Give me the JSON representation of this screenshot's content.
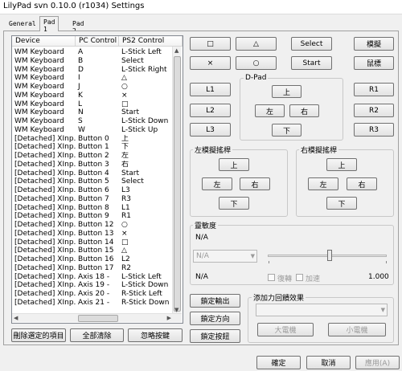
{
  "window": {
    "title": "LilyPad svn 0.10.0 (r1034) Settings"
  },
  "tabs": [
    "General",
    "Pad 1",
    "Pad 2"
  ],
  "list": {
    "headers": [
      "Device",
      "PC Control",
      "PS2 Control"
    ],
    "rows": [
      [
        "WM Keyboard",
        "A",
        "L-Stick Left"
      ],
      [
        "WM Keyboard",
        "B",
        "Select"
      ],
      [
        "WM Keyboard",
        "D",
        "L-Stick Right"
      ],
      [
        "WM Keyboard",
        "I",
        "△"
      ],
      [
        "WM Keyboard",
        "J",
        "○"
      ],
      [
        "WM Keyboard",
        "K",
        "×"
      ],
      [
        "WM Keyboard",
        "L",
        "□"
      ],
      [
        "WM Keyboard",
        "N",
        "Start"
      ],
      [
        "WM Keyboard",
        "S",
        "L-Stick Down"
      ],
      [
        "WM Keyboard",
        "W",
        "L-Stick Up"
      ],
      [
        "[Detached] XInp...",
        "Button 0",
        "上"
      ],
      [
        "[Detached] XInp...",
        "Button 1",
        "下"
      ],
      [
        "[Detached] XInp...",
        "Button 2",
        "左"
      ],
      [
        "[Detached] XInp...",
        "Button 3",
        "右"
      ],
      [
        "[Detached] XInp...",
        "Button 4",
        "Start"
      ],
      [
        "[Detached] XInp...",
        "Button 5",
        "Select"
      ],
      [
        "[Detached] XInp...",
        "Button 6",
        "L3"
      ],
      [
        "[Detached] XInp...",
        "Button 7",
        "R3"
      ],
      [
        "[Detached] XInp...",
        "Button 8",
        "L1"
      ],
      [
        "[Detached] XInp...",
        "Button 9",
        "R1"
      ],
      [
        "[Detached] XInp...",
        "Button 12",
        "○"
      ],
      [
        "[Detached] XInp...",
        "Button 13",
        "×"
      ],
      [
        "[Detached] XInp...",
        "Button 14",
        "□"
      ],
      [
        "[Detached] XInp...",
        "Button 15",
        "△"
      ],
      [
        "[Detached] XInp...",
        "Button 16",
        "L2"
      ],
      [
        "[Detached] XInp...",
        "Button 17",
        "R2"
      ],
      [
        "[Detached] XInp...",
        "Axis 18 -",
        "L-Stick Left"
      ],
      [
        "[Detached] XInp...",
        "Axis 19 -",
        "L-Stick Down"
      ],
      [
        "[Detached] XInp...",
        "Axis 20 -",
        "R-Stick Left"
      ],
      [
        "[Detached] XInp...",
        "Axis 21 -",
        "R-Stick Down"
      ]
    ]
  },
  "list_buttons": {
    "delete_selected": "刪除選定的項目",
    "clear_all": "全部清除",
    "ignore_keys": "忽略按鍵"
  },
  "face_buttons": {
    "square": "□",
    "triangle": "△",
    "select": "Select",
    "mode": "模擬",
    "cross": "×",
    "circle": "○",
    "start": "Start",
    "macro": "鼠標"
  },
  "shoulder": {
    "l1": "L1",
    "l2": "L2",
    "l3": "L3",
    "r1": "R1",
    "r2": "R2",
    "r3": "R3"
  },
  "dpad": {
    "label": "D-Pad",
    "up": "上",
    "left": "左",
    "right": "右",
    "down": "下"
  },
  "left_stick": {
    "label": "左模擬搖桿",
    "up": "上",
    "left": "左",
    "right": "右",
    "down": "下"
  },
  "right_stick": {
    "label": "右模擬搖桿",
    "up": "上",
    "left": "左",
    "right": "右",
    "down": "下"
  },
  "sensitivity": {
    "label": "靈敏度",
    "value_top": "N/A",
    "combo_value": "N/A",
    "value_bottom": "N/A",
    "slider_value": "1.000",
    "check_turbo": "復轉",
    "check_accel": "加速"
  },
  "lock_buttons": {
    "lock_input": "鎖定輸出",
    "lock_direction": "鎖定方向",
    "lock_button": "鎖定按鈕"
  },
  "force_feedback": {
    "label": "添加力回饋效果",
    "big_motor": "大電機",
    "small_motor": "小電機"
  },
  "dialog": {
    "ok": "確定",
    "cancel": "取消",
    "apply": "應用(A)"
  },
  "colors": {
    "list_border": "#828790",
    "disabled_text": "#9a9a9a",
    "group_border": "#c8c8c8"
  }
}
